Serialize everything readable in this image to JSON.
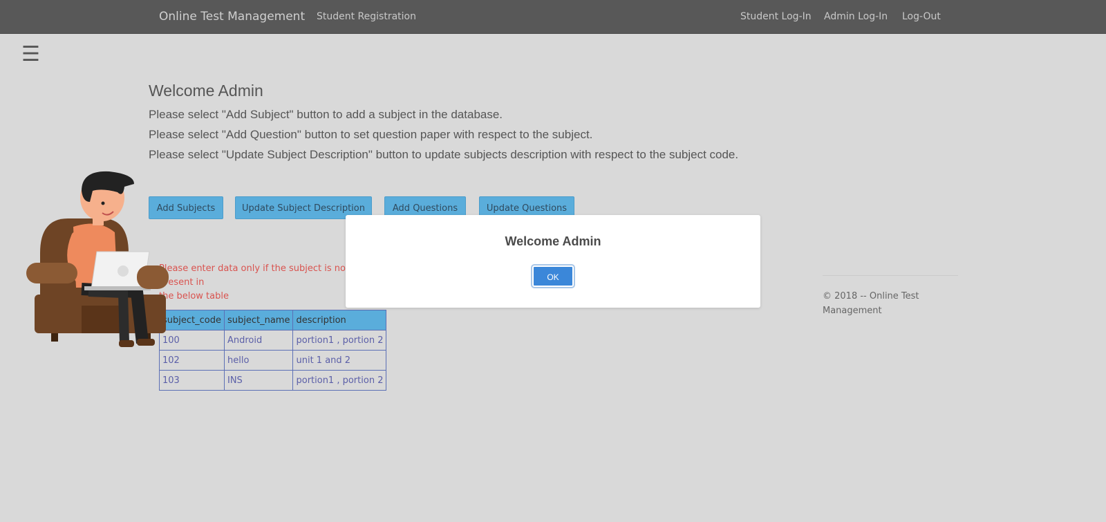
{
  "navbar": {
    "brand": "Online Test Management",
    "student_registration": "Student Registration",
    "student_login": "Student Log-In",
    "admin_login": "Admin Log-In",
    "logout": "Log-Out"
  },
  "menu_icon": "☰",
  "main": {
    "heading": "Welcome Admin",
    "instructions": [
      "Please select \"Add Subject\" button to add a subject in the database.",
      "Please select \"Add Question\" button to set question paper with respect to the subject.",
      "Please select \"Update Subject Description\" button to update subjects description with respect to the subject code."
    ],
    "buttons": {
      "add_subjects": "Add Subjects",
      "update_description": "Update Subject Description",
      "add_questions": "Add Questions",
      "update_questions": "Update Questions"
    },
    "warning_line1": "Please enter data only if the subject is not present in",
    "warning_line2": "the below table"
  },
  "table": {
    "headers": [
      "subject_code",
      "subject_name",
      "description"
    ],
    "rows": [
      [
        "100",
        "Android",
        "portion1 , portion 2"
      ],
      [
        "102",
        "hello",
        "unit 1 and 2"
      ],
      [
        "103",
        "INS",
        "portion1 , portion 2"
      ]
    ]
  },
  "footer": {
    "copyright": "© 2018 -- Online Test Management"
  },
  "modal": {
    "title": "Welcome Admin",
    "ok": "OK"
  },
  "colors": {
    "navbar": "#585858",
    "background": "#d9d9d9",
    "button": "#5aaddb",
    "warning": "#d9534f",
    "ok_button": "#3b87d9"
  }
}
